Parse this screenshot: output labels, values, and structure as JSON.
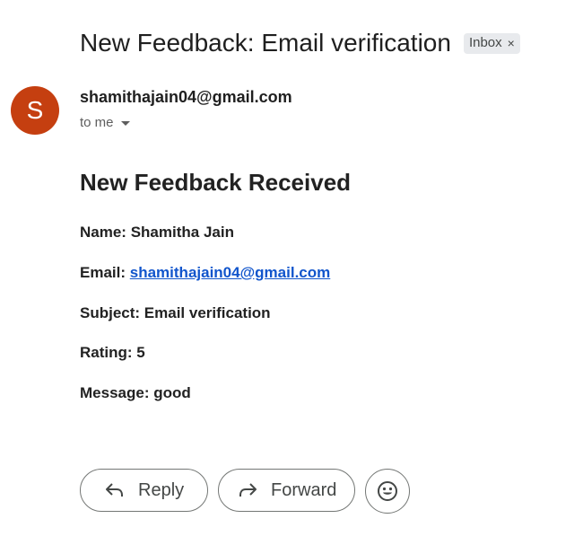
{
  "email": {
    "subject": "New Feedback: Email verification",
    "label_chip": {
      "text": "Inbox",
      "close_glyph": "×"
    },
    "avatar_letter": "S",
    "avatar_color": "#c53f10",
    "sender": "shamithajain04@gmail.com",
    "recipient": "to me"
  },
  "content": {
    "heading": "New Feedback Received",
    "name_label": "Name:",
    "name_value": "Shamitha Jain",
    "email_label": "Email:",
    "email_value": "shamithajain04@gmail.com",
    "subject_label": "Subject:",
    "subject_value": "Email verification",
    "rating_label": "Rating:",
    "rating_value": "5",
    "message_label": "Message:",
    "message_value": "good"
  },
  "actions": {
    "reply_label": "Reply",
    "forward_label": "Forward",
    "reply_icon": "reply-arrow-icon",
    "forward_icon": "forward-arrow-icon",
    "emoji_icon": "smiley-icon"
  },
  "colors": {
    "link": "#1155cc",
    "text": "#1f1f1f",
    "chip_bg": "#e8eaed"
  }
}
